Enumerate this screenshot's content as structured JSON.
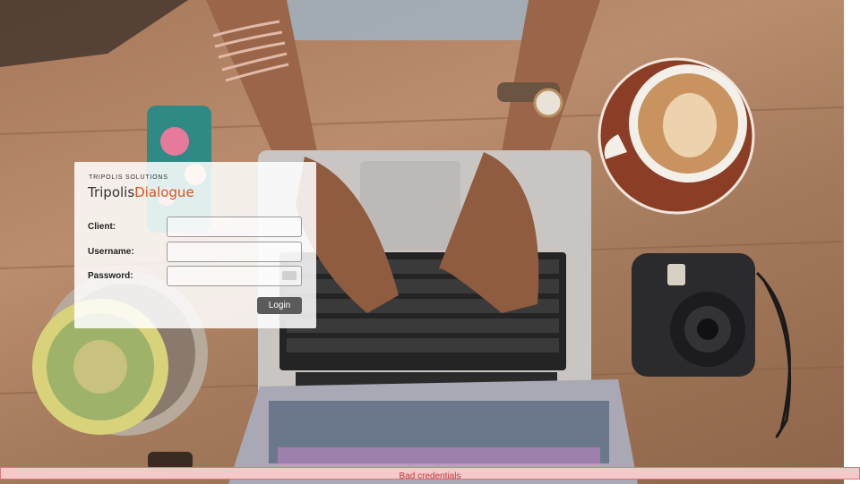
{
  "brand": {
    "company": "TRIPOLIS SOLUTIONS",
    "product_part1": "Tripolis",
    "product_part2": "Dialogue"
  },
  "form": {
    "client_label": "Client:",
    "client_value": "",
    "username_label": "Username:",
    "username_value": "",
    "password_label": "Password:",
    "password_value": "",
    "submit_label": "Login"
  },
  "error": {
    "message": "Bad credentials"
  },
  "colors": {
    "brand_accent": "#d9531e",
    "button_bg": "#5b5b5b",
    "error_bg": "#f5c8ca",
    "error_text": "#c33c42"
  }
}
